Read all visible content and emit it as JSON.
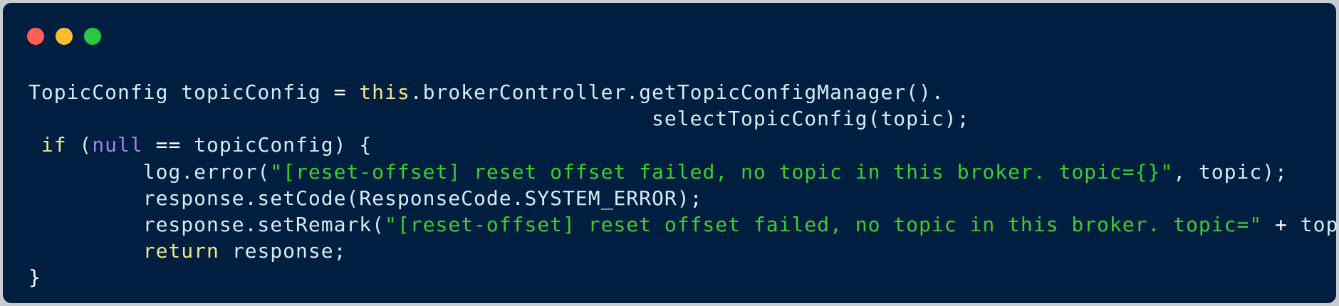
{
  "colors": {
    "background": "#001e3f",
    "dot_red": "#ff5f57",
    "dot_yellow": "#febc2e",
    "dot_green": "#28c840",
    "default": "#d6eaf5",
    "keyword": "#f2e585",
    "null_keyword": "#a77ff0",
    "string": "#3ccd2e",
    "punctuation": "#ffffff"
  },
  "window_controls": [
    {
      "name": "close",
      "color_key": "dot_red"
    },
    {
      "name": "minimize",
      "color_key": "dot_yellow"
    },
    {
      "name": "maximize",
      "color_key": "dot_green"
    }
  ],
  "code_lines": [
    [
      {
        "t": "TopicConfig topicConfig ",
        "c": "default"
      },
      {
        "t": "=",
        "c": "punctuation"
      },
      {
        "t": " ",
        "c": "default"
      },
      {
        "t": "this",
        "c": "keyword"
      },
      {
        "t": ".brokerController.getTopicConfigManager().",
        "c": "default"
      }
    ],
    [
      {
        "t": "                                                 selectTopicConfig(topic);",
        "c": "default"
      }
    ],
    [
      {
        "t": " ",
        "c": "default"
      },
      {
        "t": "if",
        "c": "keyword"
      },
      {
        "t": " (",
        "c": "default"
      },
      {
        "t": "null",
        "c": "null_keyword"
      },
      {
        "t": " ",
        "c": "default"
      },
      {
        "t": "==",
        "c": "punctuation"
      },
      {
        "t": " topicConfig) {",
        "c": "default"
      }
    ],
    [
      {
        "t": "         log.error(",
        "c": "default"
      },
      {
        "t": "\"[reset-offset] reset offset failed, no topic in this broker. topic={}\"",
        "c": "string"
      },
      {
        "t": ", topic);",
        "c": "default"
      }
    ],
    [
      {
        "t": "         response.setCode(ResponseCode.SYSTEM_ERROR);",
        "c": "default"
      }
    ],
    [
      {
        "t": "         response.setRemark(",
        "c": "default"
      },
      {
        "t": "\"[reset-offset] reset offset failed, no topic in this broker. topic=\"",
        "c": "string"
      },
      {
        "t": " ",
        "c": "default"
      },
      {
        "t": "+",
        "c": "punctuation"
      },
      {
        "t": " topic);",
        "c": "default"
      }
    ],
    [
      {
        "t": "         ",
        "c": "default"
      },
      {
        "t": "return",
        "c": "keyword"
      },
      {
        "t": " response;",
        "c": "default"
      }
    ],
    [
      {
        "t": "}",
        "c": "punctuation"
      }
    ]
  ]
}
